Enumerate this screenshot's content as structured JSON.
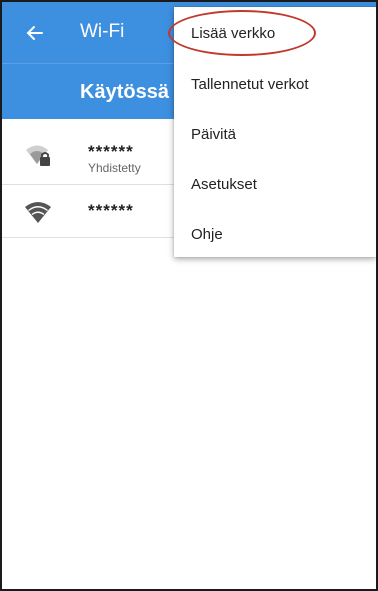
{
  "appbar": {
    "back_icon": "arrow-left-icon",
    "title": "Wi-Fi"
  },
  "enable_row": {
    "label": "Käytössä"
  },
  "networks": [
    {
      "name": "******",
      "status": "Yhdistetty",
      "icon": "wifi-lock-icon"
    },
    {
      "name": "******",
      "status": "",
      "icon": "wifi-icon"
    }
  ],
  "menu": {
    "items": [
      {
        "label": "Lisää verkko"
      },
      {
        "label": "Tallennetut verkot"
      },
      {
        "label": "Päivitä"
      },
      {
        "label": "Asetukset"
      },
      {
        "label": "Ohje"
      }
    ],
    "highlighted": "Lisää verkko"
  },
  "colors": {
    "primary": "#3d8fe0",
    "annotation": "#c0392b"
  }
}
